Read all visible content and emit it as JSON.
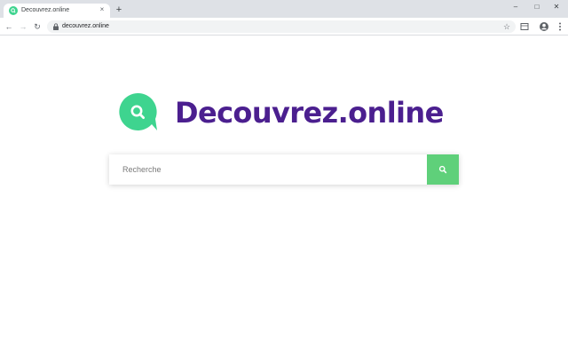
{
  "browser": {
    "tab": {
      "title": "Decouvrez.online",
      "close_label": "×"
    },
    "new_tab_label": "+",
    "window_controls": {
      "minimize": "–",
      "maximize": "□",
      "close": "✕"
    },
    "nav": {
      "back": "←",
      "forward": "→",
      "reload": "↻"
    },
    "address_bar": {
      "url": "decouvrez.online"
    },
    "icons": [
      "lock-icon",
      "star-icon",
      "media-icon",
      "profile-icon",
      "menu-icon"
    ]
  },
  "page": {
    "logo": {
      "text": "Decouvrez.online",
      "bubble_color": "#3ed48f",
      "text_color": "#4b1f8f"
    },
    "search": {
      "placeholder": "Recherche",
      "button_color": "#5fd07a"
    }
  }
}
